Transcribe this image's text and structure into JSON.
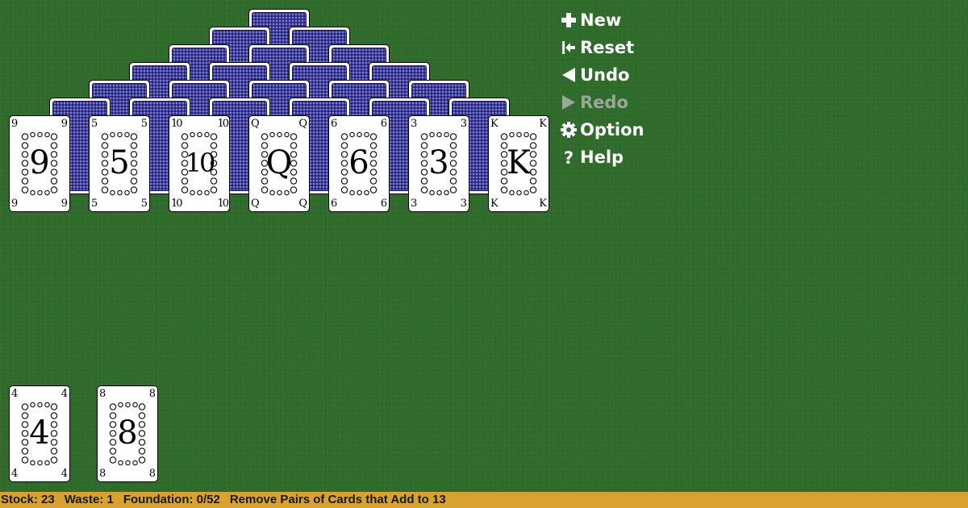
{
  "menu": {
    "new_label": "New",
    "reset_label": "Reset",
    "undo_label": "Undo",
    "redo_label": "Redo",
    "option_label": "Option",
    "help_label": "Help"
  },
  "pyramid_bottom_row": [
    "9",
    "5",
    "10",
    "Q",
    "6",
    "3",
    "K"
  ],
  "pyramid_facedown_rows": 6,
  "stock_cards": [
    "4"
  ],
  "waste_cards": [
    "8"
  ],
  "status": {
    "stock": "Stock: 23",
    "waste": "Waste: 1",
    "foundation": "Foundation: 0/52",
    "message": "Remove Pairs of Cards that Add to 13"
  },
  "colors": {
    "felt": "#2f6b2a",
    "card_back": "#3a3a9a",
    "status_bar": "#d9a22f",
    "menu_text": "#ffffff",
    "menu_disabled": "#9aa79a"
  },
  "icons": {
    "new": "plus-icon",
    "reset": "reset-icon",
    "undo": "undo-icon",
    "redo": "redo-icon",
    "option": "gear-icon",
    "help": "help-icon"
  }
}
